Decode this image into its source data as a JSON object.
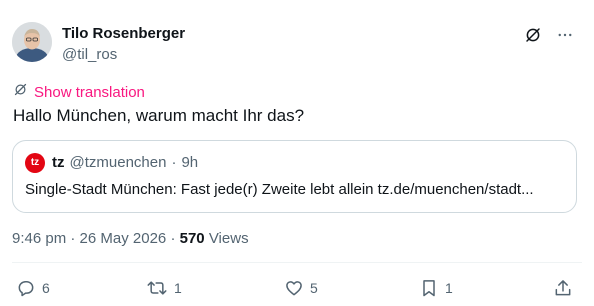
{
  "author": {
    "name": "Tilo Rosenberger",
    "handle": "@til_ros"
  },
  "translate": {
    "label": "Show translation"
  },
  "tweet": {
    "text": "Hallo München, warum macht Ihr das?"
  },
  "quote": {
    "logo_text": "tz",
    "name": "tz",
    "handle": "@tzmuenchen",
    "separator": "·",
    "time": "9h",
    "text": "Single-Stadt München: Fast jede(r) Zweite lebt allein tz.de/muenchen/stadt..."
  },
  "meta": {
    "time": "9:46 pm",
    "separator1": "·",
    "date": "26 May 2026",
    "separator2": "·",
    "views_count": "570",
    "views_label": "Views"
  },
  "actions": {
    "replies": "6",
    "reposts": "1",
    "likes": "5",
    "bookmarks": "1"
  },
  "colors": {
    "accent_pink": "#f91880",
    "text_primary": "#0f1419",
    "text_secondary": "#536471",
    "border": "#cfd9de",
    "tz_red": "#e30613"
  },
  "icons": [
    "grok-icon",
    "more-icon",
    "translate-icon",
    "reply-icon",
    "repost-icon",
    "like-icon",
    "bookmark-icon",
    "share-icon"
  ]
}
